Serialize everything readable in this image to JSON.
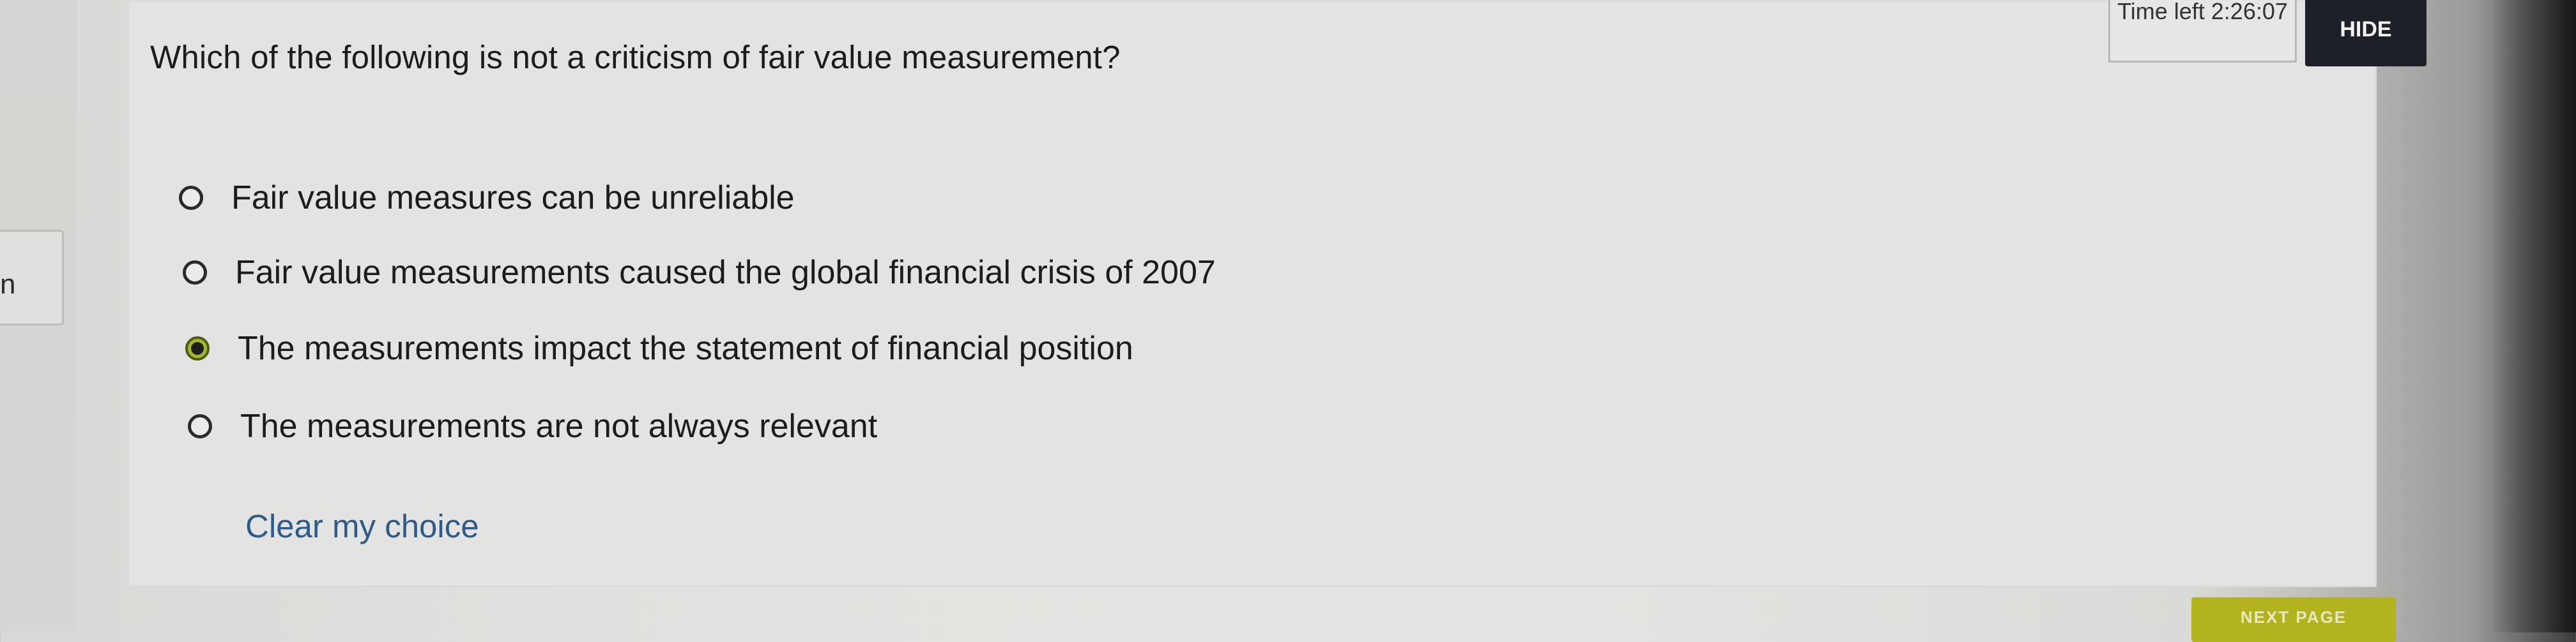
{
  "left_tab": {
    "label": "n"
  },
  "question": {
    "text": "Which of the following is not a criticism of fair value measurement?"
  },
  "options": [
    {
      "label": "Fair value measures can be unreliable",
      "selected": false
    },
    {
      "label": "Fair value measurements caused the global financial crisis of 2007",
      "selected": false
    },
    {
      "label": "The measurements impact the statement of financial position",
      "selected": true
    },
    {
      "label": "The measurements are not always relevant",
      "selected": false
    }
  ],
  "clear_choice_label": "Clear my choice",
  "timer": {
    "text": "Time left 2:26:07"
  },
  "hide_button_label": "HIDE",
  "next_page_label": "NEXT PAGE",
  "colors": {
    "selected_radio_fill": "#a9b828",
    "hide_button_bg": "#1d2027",
    "next_button_bg": "#b3b21f",
    "link_color": "#2d5a8a"
  }
}
